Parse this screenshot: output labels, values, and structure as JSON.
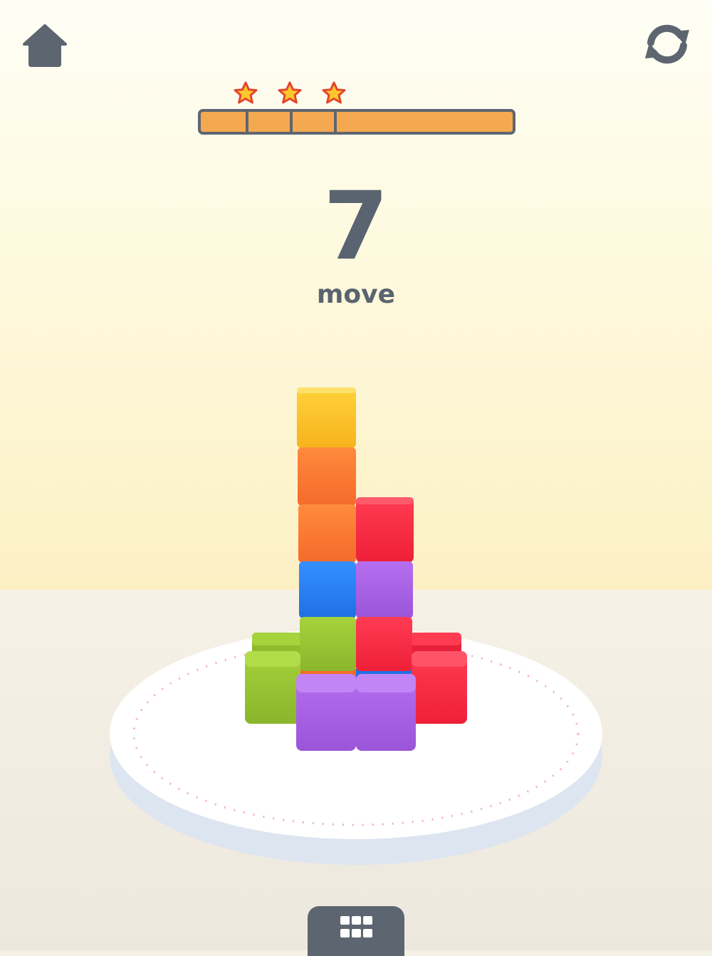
{
  "hud": {
    "home_icon": "home-icon",
    "restart_icon": "restart-icon",
    "menu_icon": "grid-menu-icon",
    "stars_earned": 3,
    "star_icon": "star-icon"
  },
  "counter": {
    "value": "7",
    "label": "move"
  },
  "colors": {
    "icon": "#5d6670",
    "progress_fill": "#f4a950",
    "progress_border": "#5f6670",
    "star": "#ffc72c",
    "star_outline": "#e2462e",
    "yellow": "#fcbe24",
    "orange": "#fa7a33",
    "red": "#f52a44",
    "blue": "#2a7fef",
    "purple": "#ab62e2",
    "green": "#9ac534"
  },
  "tower": {
    "blocks": [
      {
        "color": "yellow"
      },
      {
        "color": "orange"
      },
      {
        "color": "orange"
      },
      {
        "color": "red"
      },
      {
        "color": "blue"
      },
      {
        "color": "purple"
      },
      {
        "color": "green"
      },
      {
        "color": "red"
      },
      {
        "color": "green"
      },
      {
        "color": "red"
      },
      {
        "color": "purple"
      },
      {
        "color": "purple"
      }
    ]
  }
}
